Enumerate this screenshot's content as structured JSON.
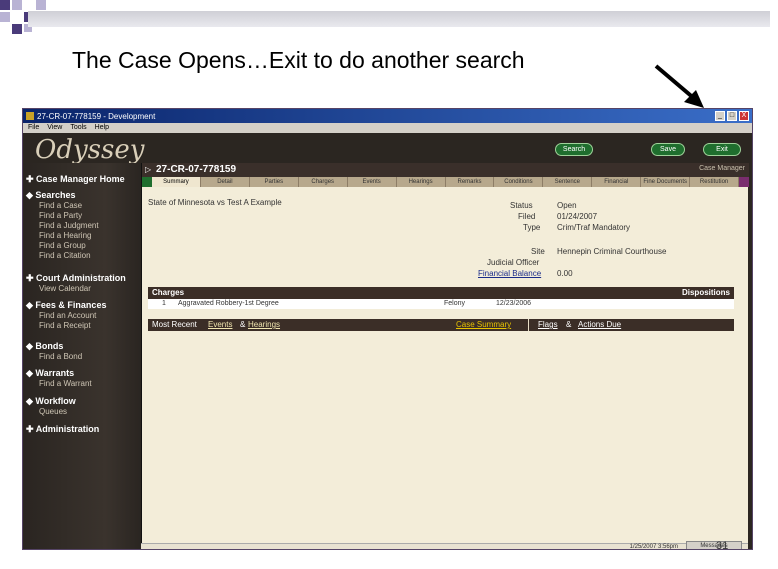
{
  "slide": {
    "title": "The Case Opens…Exit to do another search",
    "page_number": "31"
  },
  "window": {
    "title": "27-CR-07-778159 - Development",
    "menu": [
      "File",
      "View",
      "Tools",
      "Help"
    ],
    "controls": [
      "_",
      "□",
      "X"
    ]
  },
  "app": {
    "logo": "Odyssey",
    "buttons": {
      "search": "Search",
      "save": "Save",
      "exit": "Exit"
    }
  },
  "sidebar": {
    "sections": [
      {
        "label": "Case Manager Home",
        "items": []
      },
      {
        "label": "Searches",
        "items": [
          "Find a Case",
          "Find a Party",
          "Find a Judgment",
          "Find a Hearing",
          "Find a Group",
          "Find a Citation"
        ]
      },
      {
        "label": "Court Administration",
        "items": [
          "View Calendar"
        ]
      },
      {
        "label": "Fees & Finances",
        "items": [
          "Find an Account",
          "Find a Receipt"
        ]
      },
      {
        "label": "Bonds",
        "items": [
          "Find a Bond"
        ]
      },
      {
        "label": "Warrants",
        "items": [
          "Find a Warrant"
        ]
      },
      {
        "label": "Workflow",
        "items": [
          "Queues"
        ]
      },
      {
        "label": "Administration",
        "items": []
      }
    ]
  },
  "case": {
    "number": "27-CR-07-778159",
    "manager_label": "Case Manager",
    "tabs": [
      "Summary",
      "Detail",
      "Parties",
      "Charges",
      "Events",
      "Hearings",
      "Remarks",
      "Conditions",
      "Sentence",
      "Financial",
      "Fine Documents",
      "Restitution"
    ],
    "party_caption": "State of Minnesota vs Test A Example",
    "fields": {
      "status_label": "Status",
      "status_value": "Open",
      "filed_label": "Filed",
      "filed_value": "01/24/2007",
      "type_label": "Type",
      "type_value": "Crim/Traf Mandatory",
      "site_label": "Site",
      "site_value": "Hennepin Criminal Courthouse",
      "judicial_label": "Judicial Officer",
      "judicial_value": "",
      "balance_label": "Financial Balance",
      "balance_value": "0.00"
    },
    "charges": {
      "header": "Charges",
      "dispositions_header": "Dispositions",
      "rows": [
        {
          "num": "1",
          "desc": "Aggravated Robbery-1st Degree",
          "level": "Felony",
          "date": "12/23/2006"
        }
      ]
    },
    "events_bar": {
      "prefix": "Most Recent",
      "events_link": "Events",
      "amp": "&",
      "hearings_link": "Hearings",
      "summary_link": "Case Summary",
      "flags_link": "Flags",
      "amp2": "&",
      "actions_link": "Actions Due"
    }
  },
  "statusbar": {
    "timestamp": "1/25/2007 3:56pm",
    "messages": "Messages"
  },
  "colors": {
    "accent_dark": "#3b2e27",
    "panel_bg": "#f3edd9",
    "link_blue": "#1a2b8a",
    "link_gold": "#c8a000",
    "green_button": "#1f6e2e"
  }
}
